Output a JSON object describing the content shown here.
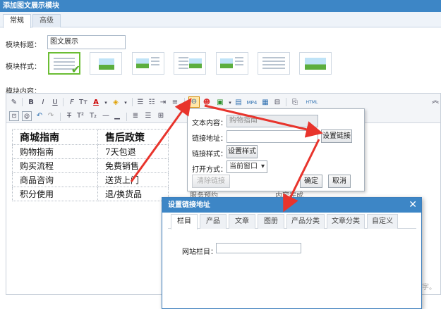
{
  "window": {
    "title": "添加图文展示模块"
  },
  "tabs": [
    {
      "label": "常规"
    },
    {
      "label": "高级"
    }
  ],
  "form": {
    "title_label": "模块标题：",
    "title_value": "图文展示",
    "style_label": "模块样式：",
    "content_label": "模块内容："
  },
  "style_thumbs": [
    {
      "kind": "lines",
      "selected": true
    },
    {
      "kind": "image-left"
    },
    {
      "kind": "image-left-lines"
    },
    {
      "kind": "image-right-lines"
    },
    {
      "kind": "image-left-lines"
    },
    {
      "kind": "image-top-lines"
    },
    {
      "kind": "image-wide"
    }
  ],
  "toolbar": {
    "html_label": "HTML",
    "row1_icons": [
      "eraser-icon",
      "bold-icon",
      "italic-icon",
      "underline-icon",
      "font-family-icon",
      "font-size-icon",
      "font-color-icon",
      "highlight-icon",
      "ordered-list-icon",
      "unordered-list-icon",
      "indent-icon",
      "justify-icon",
      "link-icon",
      "emoticon-icon",
      "image-icon",
      "flash-icon",
      "media-icon",
      "table-icon",
      "hr-icon",
      "template-icon",
      "html-icon"
    ],
    "row2_icons": [
      "fullscreen-icon",
      "select-all-icon",
      "undo-icon",
      "redo-icon",
      "strikethrough-icon",
      "superscript-icon",
      "subscript-icon",
      "line-icon",
      "dash-icon",
      "align-left-icon",
      "align-center-icon",
      "align-right-icon"
    ]
  },
  "content_table": {
    "headers": [
      "商城指南",
      "售后政策"
    ],
    "rows": [
      [
        "购物指南",
        "7天包退"
      ],
      [
        "购买流程",
        "免费销售"
      ],
      [
        "商品咨询",
        "送货上门"
      ],
      [
        "积分使用",
        "退/换货品"
      ]
    ],
    "ghost": [
      "服务预约",
      "内容完成"
    ]
  },
  "link_popup": {
    "text_label": "文本内容：",
    "text_value": "购物指南",
    "url_label": "链接地址：",
    "url_value": "",
    "set_link_button": "设置链接",
    "style_label": "链接样式：",
    "set_style_button": "设置样式",
    "open_label": "打开方式：",
    "open_value": "当前窗口",
    "remove_button": "清除链接",
    "ok_button": "确定",
    "cancel_button": "取消"
  },
  "dialog": {
    "title": "设置链接地址",
    "close": "✕",
    "tabs": [
      "栏目",
      "产品",
      "文章",
      "图册",
      "产品分类",
      "文章分类",
      "自定义"
    ],
    "active_tab": 0,
    "site_column_label": "网站栏目：",
    "site_column_value": ""
  },
  "editor_footer": {
    "char_note": "字。"
  },
  "colors": {
    "titlebar": "#3d86c6",
    "accent_green": "#6bbd34",
    "arrow_red": "#e8342c"
  }
}
